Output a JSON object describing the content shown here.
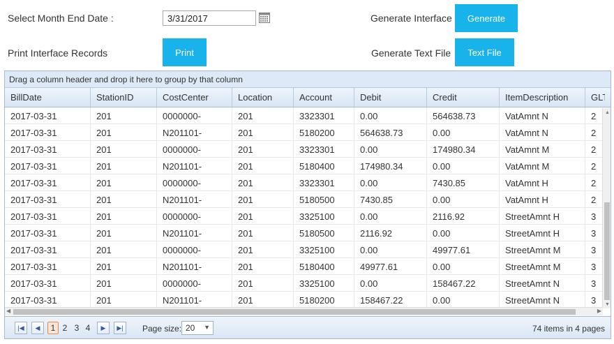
{
  "form": {
    "month_end_label": "Select Month End Date :",
    "month_end_value": "3/31/2017",
    "print_label": "Print Interface Records",
    "print_button": "Print",
    "generate_interface_label": "Generate Interface",
    "generate_button": "Generate",
    "generate_text_label": "Generate Text File",
    "text_file_button": "Text File"
  },
  "grid": {
    "group_panel_text": "Drag a column header and drop it here to group by that column",
    "columns": [
      "BillDate",
      "StationID",
      "CostCenter",
      "Location",
      "Account",
      "Debit",
      "Credit",
      "ItemDescription",
      "GLT"
    ],
    "rows": [
      [
        "2017-03-31",
        "201",
        "0000000-",
        "201",
        "3323301",
        "0.00",
        "564638.73",
        "VatAmnt N",
        "2"
      ],
      [
        "2017-03-31",
        "201",
        "N201101-",
        "201",
        "5180200",
        "564638.73",
        "0.00",
        "VatAmnt N",
        "2"
      ],
      [
        "2017-03-31",
        "201",
        "0000000-",
        "201",
        "3323301",
        "0.00",
        "174980.34",
        "VatAmnt M",
        "2"
      ],
      [
        "2017-03-31",
        "201",
        "N201101-",
        "201",
        "5180400",
        "174980.34",
        "0.00",
        "VatAmnt M",
        "2"
      ],
      [
        "2017-03-31",
        "201",
        "0000000-",
        "201",
        "3323301",
        "0.00",
        "7430.85",
        "VatAmnt H",
        "2"
      ],
      [
        "2017-03-31",
        "201",
        "N201101-",
        "201",
        "5180500",
        "7430.85",
        "0.00",
        "VatAmnt H",
        "2"
      ],
      [
        "2017-03-31",
        "201",
        "0000000-",
        "201",
        "3325100",
        "0.00",
        "2116.92",
        "StreetAmnt H",
        "3"
      ],
      [
        "2017-03-31",
        "201",
        "N201101-",
        "201",
        "5180500",
        "2116.92",
        "0.00",
        "StreetAmnt H",
        "3"
      ],
      [
        "2017-03-31",
        "201",
        "0000000-",
        "201",
        "3325100",
        "0.00",
        "49977.61",
        "StreetAmnt M",
        "3"
      ],
      [
        "2017-03-31",
        "201",
        "N201101-",
        "201",
        "5180400",
        "49977.61",
        "0.00",
        "StreetAmnt M",
        "3"
      ],
      [
        "2017-03-31",
        "201",
        "0000000-",
        "201",
        "3325100",
        "0.00",
        "158467.22",
        "StreetAmnt N",
        "3"
      ],
      [
        "2017-03-31",
        "201",
        "N201101-",
        "201",
        "5180200",
        "158467.22",
        "0.00",
        "StreetAmnt N",
        "3"
      ]
    ]
  },
  "pager": {
    "first_icon": "first-page-icon",
    "prev_icon": "prev-page-icon",
    "next_icon": "next-page-icon",
    "last_icon": "last-page-icon",
    "pages": [
      "1",
      "2",
      "3",
      "4"
    ],
    "current_page": "1",
    "page_size_label": "Page size:",
    "page_size_value": "20",
    "info": "74 items in 4 pages"
  },
  "colors": {
    "button_bg": "#17b3ea",
    "header_bg": "#dde9f6",
    "active_page": "#e58a4f"
  }
}
